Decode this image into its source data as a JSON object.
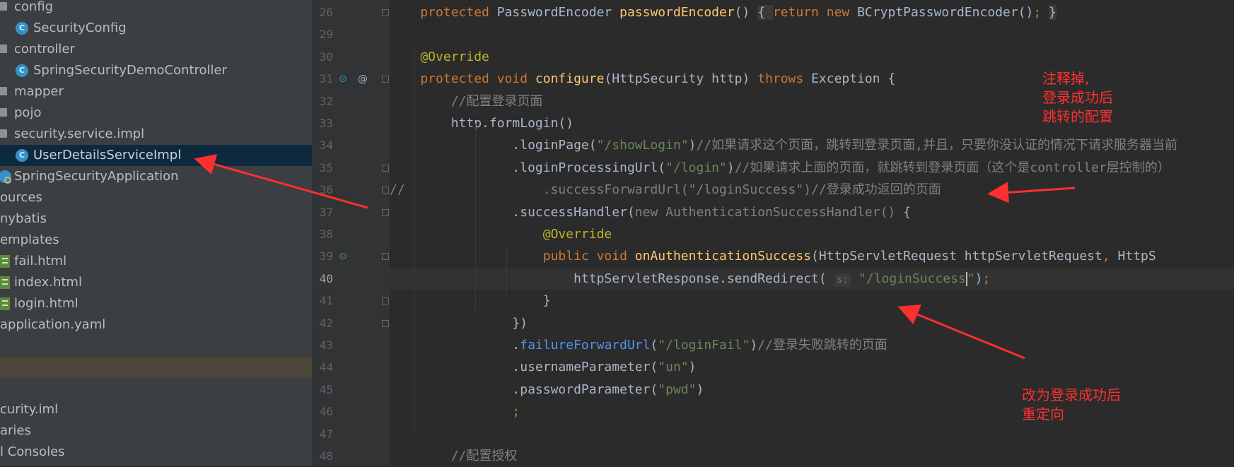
{
  "project_tree": {
    "items": [
      {
        "label": "config",
        "kind": "folder"
      },
      {
        "label": "SecurityConfig",
        "kind": "class"
      },
      {
        "label": "controller",
        "kind": "folder"
      },
      {
        "label": "SpringSecurityDemoController",
        "kind": "class"
      },
      {
        "label": "mapper",
        "kind": "folder"
      },
      {
        "label": "pojo",
        "kind": "folder"
      },
      {
        "label": "security.service.impl",
        "kind": "folder"
      },
      {
        "label": "UserDetailsServiceImpl",
        "kind": "class",
        "selected": true
      },
      {
        "label": "SpringSecurityApplication",
        "kind": "app-class"
      },
      {
        "label": "ources",
        "kind": "folder-cut"
      },
      {
        "label": "nybatis",
        "kind": "folder-cut"
      },
      {
        "label": "emplates",
        "kind": "folder-cut"
      },
      {
        "label": "fail.html",
        "kind": "html"
      },
      {
        "label": "index.html",
        "kind": "html"
      },
      {
        "label": "login.html",
        "kind": "html"
      },
      {
        "label": "application.yaml",
        "kind": "file-cut"
      },
      {
        "label": "",
        "kind": "blank"
      },
      {
        "label": "",
        "kind": "blank-hover"
      },
      {
        "label": "",
        "kind": "blank"
      },
      {
        "label": "curity.iml",
        "kind": "file-cut"
      },
      {
        "label": "aries",
        "kind": "file-cut"
      },
      {
        "label": "l Consoles",
        "kind": "file-cut"
      }
    ]
  },
  "editor": {
    "current_line": "40",
    "lines": [
      {
        "n": "26",
        "tokens": [
          [
            "kw",
            "    protected "
          ],
          [
            "typ",
            "PasswordEncoder "
          ],
          [
            "fn",
            "passwordEncoder"
          ],
          [
            "typ",
            "() "
          ],
          [
            "lam",
            "{ "
          ],
          [
            "kw",
            "return new "
          ],
          [
            "typ",
            "BCryptPasswordEncoder()"
          ],
          [
            "kw",
            "; "
          ],
          [
            "lam",
            "}"
          ]
        ]
      },
      {
        "n": "29",
        "tokens": []
      },
      {
        "n": "30",
        "tokens": [
          [
            "ann",
            "    @Override"
          ]
        ]
      },
      {
        "n": "31",
        "tokens": [
          [
            "kw",
            "    protected void "
          ],
          [
            "fn",
            "configure"
          ],
          [
            "typ",
            "(HttpSecurity http) "
          ],
          [
            "kw",
            "throws "
          ],
          [
            "typ",
            "Exception {"
          ]
        ]
      },
      {
        "n": "32",
        "tokens": [
          [
            "cmt",
            "        //配置登录页面"
          ]
        ]
      },
      {
        "n": "33",
        "tokens": [
          [
            "typ",
            "        http.formLogin()"
          ]
        ]
      },
      {
        "n": "34",
        "tokens": [
          [
            "typ",
            "                .loginPage("
          ],
          [
            "str",
            "\"/showLogin\""
          ],
          [
            "typ",
            ")"
          ],
          [
            "cmt",
            "//如果请求这个页面，跳转到登录页面,并且，只要你没认证的情况下请求服务器当前"
          ]
        ]
      },
      {
        "n": "35",
        "tokens": [
          [
            "typ",
            "                .loginProcessingUrl("
          ],
          [
            "str",
            "\"/login\""
          ],
          [
            "typ",
            ")"
          ],
          [
            "cmt",
            "//如果请求上面的页面，就跳转到登录页面（这个是controller层控制的）"
          ]
        ]
      },
      {
        "n": "36",
        "tokens": [
          [
            "cmt",
            "//                  .successForwardUrl(\"/loginSuccess\")//登录成功返回的页面"
          ]
        ]
      },
      {
        "n": "37",
        "tokens": [
          [
            "typ",
            "                .successHandler("
          ],
          [
            "gray",
            "new AuthenticationSuccessHandler() "
          ],
          [
            "typ",
            "{"
          ]
        ]
      },
      {
        "n": "38",
        "tokens": [
          [
            "ann",
            "                    @Override"
          ]
        ]
      },
      {
        "n": "39",
        "tokens": [
          [
            "kw",
            "                    public void "
          ],
          [
            "fn",
            "onAuthenticationSuccess"
          ],
          [
            "typ",
            "(HttpServletRequest httpServletRequest"
          ],
          [
            "kw",
            ", "
          ],
          [
            "typ",
            "HttpS"
          ]
        ]
      },
      {
        "n": "40",
        "tokens": [
          [
            "typ",
            "                        httpServletResponse.sendRedirect( "
          ],
          [
            "hint",
            "s:"
          ],
          [
            "str",
            " \"/loginSuccess"
          ],
          [
            "caret",
            ""
          ],
          [
            "str",
            "\""
          ],
          [
            "typ",
            ")"
          ],
          [
            "kw",
            ";"
          ]
        ]
      },
      {
        "n": "41",
        "tokens": [
          [
            "typ",
            "                    }"
          ]
        ]
      },
      {
        "n": "42",
        "tokens": [
          [
            "typ",
            "                })"
          ]
        ]
      },
      {
        "n": "43",
        "tokens": [
          [
            "typ",
            "                ."
          ],
          [
            "blue",
            "failureForwardUrl"
          ],
          [
            "typ",
            "("
          ],
          [
            "str",
            "\"/loginFail\""
          ],
          [
            "typ",
            ")"
          ],
          [
            "cmt",
            "//登录失败跳转的页面"
          ]
        ]
      },
      {
        "n": "44",
        "tokens": [
          [
            "typ",
            "                .usernameParameter("
          ],
          [
            "str",
            "\"un\""
          ],
          [
            "typ",
            ")"
          ]
        ]
      },
      {
        "n": "45",
        "tokens": [
          [
            "typ",
            "                .passwordParameter("
          ],
          [
            "str",
            "\"pwd\""
          ],
          [
            "typ",
            ")"
          ]
        ]
      },
      {
        "n": "46",
        "tokens": [
          [
            "kw",
            "                ;"
          ]
        ]
      },
      {
        "n": "47",
        "tokens": []
      },
      {
        "n": "48",
        "tokens": [
          [
            "cmt",
            "        //配置授权"
          ]
        ]
      }
    ]
  },
  "annotations": {
    "note_top": "注释掉,\n登录成功后\n跳转的配置",
    "note_bottom": "改为登录成功后\n重定向",
    "color": "#ff2f2f"
  },
  "colors": {
    "keyword": "#cc7832",
    "function": "#ffc66d",
    "string": "#6a8759",
    "annotation": "#bbb529",
    "comment": "#808080",
    "selection": "#0d293e"
  }
}
